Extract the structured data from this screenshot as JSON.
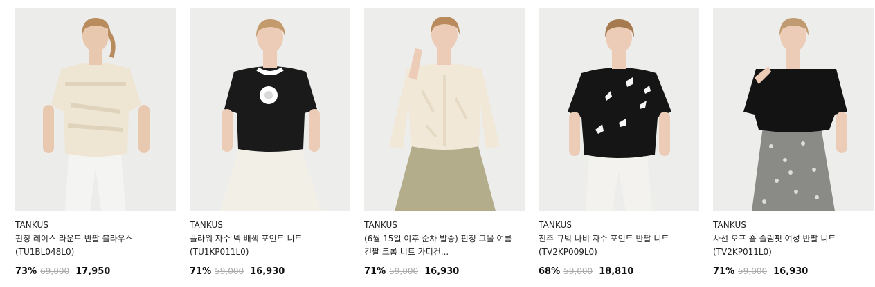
{
  "products": [
    {
      "brand": "TANKUS",
      "title": "펀칭 레이스 라운드 반팔 블라우스 (TU1BL048L0)",
      "discount": "73%",
      "original_price": "69,000",
      "sale_price": "17,950",
      "colors": {
        "bg": "#ececeb",
        "top": "#efe5d3",
        "bottom": "#f4f4f2",
        "skin": "#e9c8b0",
        "hair": "#b98c5e",
        "accent": "#e0d3bb"
      }
    },
    {
      "brand": "TANKUS",
      "title": "플라워 자수 넥 배색 포인트 니트 (TU1KP011L0)",
      "discount": "71%",
      "original_price": "59,000",
      "sale_price": "16,930",
      "colors": {
        "bg": "#ededec",
        "top": "#1a1a1a",
        "bottom": "#f2efe7",
        "skin": "#ecccb6",
        "hair": "#c29a6c",
        "accent": "#ffffff"
      }
    },
    {
      "brand": "TANKUS",
      "title": "(6월 15일 이후 순차 발송) 펀칭 그물 여름 긴팔 크롭 니트 가디건...",
      "discount": "71%",
      "original_price": "59,000",
      "sale_price": "16,930",
      "colors": {
        "bg": "#ededec",
        "top": "#f1e8d8",
        "bottom": "#b3ad8c",
        "skin": "#ecccb6",
        "hair": "#b88a5c",
        "accent": "#e6dac4"
      }
    },
    {
      "brand": "TANKUS",
      "title": "진주 큐빅 나비 자수 포인트 반팔 니트 (TV2KP009L0)",
      "discount": "68%",
      "original_price": "59,000",
      "sale_price": "18,810",
      "colors": {
        "bg": "#ededec",
        "top": "#151515",
        "bottom": "#f3f2ee",
        "skin": "#ecccb6",
        "hair": "#a67a4f",
        "accent": "#f5f5f5"
      }
    },
    {
      "brand": "TANKUS",
      "title": "사선 오프 숄 슬림핏 여성 반팔 니트 (TV2KP011L0)",
      "discount": "71%",
      "original_price": "59,000",
      "sale_price": "16,930",
      "colors": {
        "bg": "#ededec",
        "top": "#131313",
        "bottom": "#8a8a86",
        "skin": "#ecccb6",
        "hair": "#c09a70",
        "accent": "#dcdcd8"
      }
    }
  ]
}
